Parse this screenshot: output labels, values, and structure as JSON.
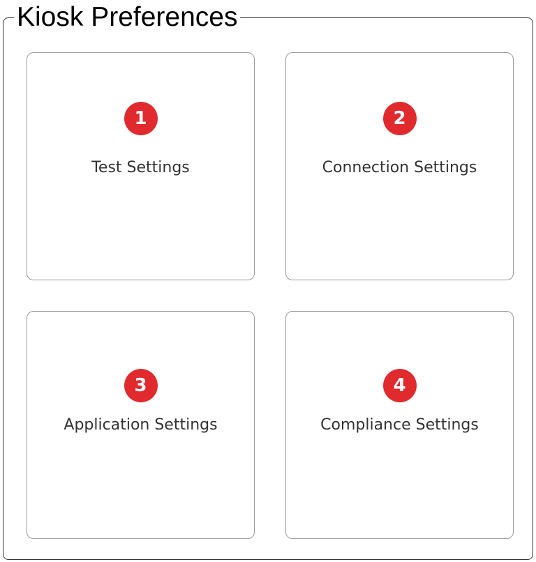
{
  "panel": {
    "title": "Kiosk Preferences"
  },
  "cards": [
    {
      "number": "1",
      "label": "Test Settings"
    },
    {
      "number": "2",
      "label": "Connection Settings"
    },
    {
      "number": "3",
      "label": "Application Settings"
    },
    {
      "number": "4",
      "label": "Compliance Settings"
    }
  ],
  "colors": {
    "badge": "#e12a2e",
    "card_border": "#9a9a9a",
    "label": "#333333"
  }
}
